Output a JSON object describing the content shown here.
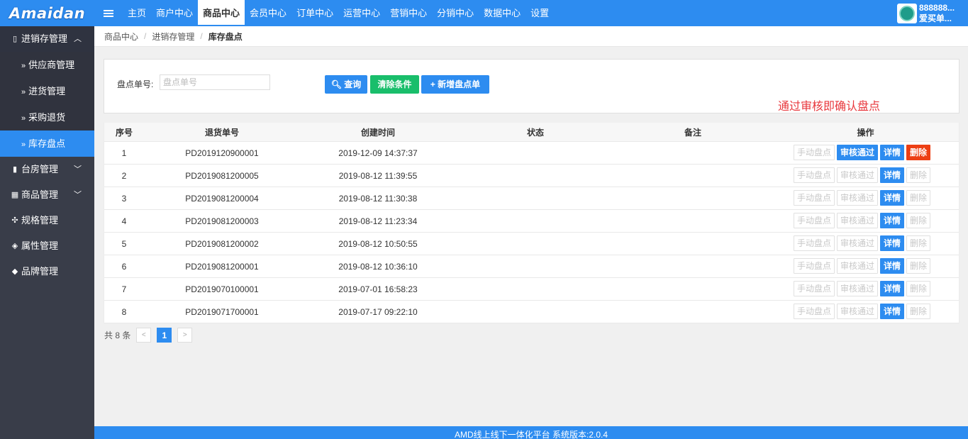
{
  "brand": {
    "logo": "Amaidan"
  },
  "topnav": [
    "主页",
    "商户中心",
    "商品中心",
    "会员中心",
    "订单中心",
    "运营中心",
    "营销中心",
    "分销中心",
    "数据中心",
    "设置"
  ],
  "user": {
    "id": "888888...",
    "name": "爱买单..."
  },
  "sidebar": {
    "group_inventory": "进销存管理",
    "subs": [
      "供应商管理",
      "进货管理",
      "采购退货",
      "库存盘点"
    ],
    "groups": [
      "台房管理",
      "商品管理",
      "规格管理",
      "属性管理",
      "品牌管理"
    ]
  },
  "breadcrumb": [
    "商品中心",
    "进销存管理",
    "库存盘点"
  ],
  "filter": {
    "label": "盘点单号:",
    "placeholder": "盘点单号",
    "search": "查询",
    "clear": "清除条件",
    "add": "新增盘点单",
    "note": "通过审核即确认盘点"
  },
  "table": {
    "headers": [
      "序号",
      "退货单号",
      "创建时间",
      "状态",
      "备注",
      "操作"
    ],
    "actions": [
      "手动盘点",
      "审核通过",
      "详情",
      "删除"
    ],
    "rows": [
      {
        "no": "1",
        "code": "PD2019120900001",
        "time": "2019-12-09 14:37:37"
      },
      {
        "no": "2",
        "code": "PD2019081200005",
        "time": "2019-08-12 11:39:55"
      },
      {
        "no": "3",
        "code": "PD2019081200004",
        "time": "2019-08-12 11:30:38"
      },
      {
        "no": "4",
        "code": "PD2019081200003",
        "time": "2019-08-12 11:23:34"
      },
      {
        "no": "5",
        "code": "PD2019081200002",
        "time": "2019-08-12 10:50:55"
      },
      {
        "no": "6",
        "code": "PD2019081200001",
        "time": "2019-08-12 10:36:10"
      },
      {
        "no": "7",
        "code": "PD2019070100001",
        "time": "2019-07-01 16:58:23"
      },
      {
        "no": "8",
        "code": "PD2019071700001",
        "time": "2019-07-17 09:22:10"
      }
    ]
  },
  "pager": {
    "total": "共 8 条",
    "current": "1"
  },
  "footer": "AMD线上线下一体化平台 系统版本:2.0.4",
  "colors": {
    "primary": "#2d8cf0",
    "success": "#19be6b",
    "danger": "#ed3f14",
    "sidebar": "#393d49"
  }
}
